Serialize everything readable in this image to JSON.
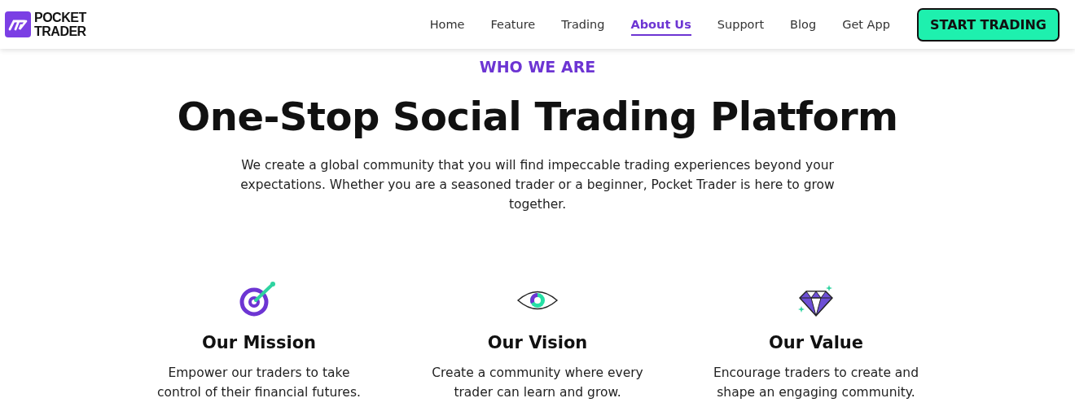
{
  "header": {
    "logo": {
      "line_1": "POCKET",
      "line_2": "TRADER"
    },
    "nav": [
      {
        "label": "Home",
        "selected": false
      },
      {
        "label": "Feature",
        "selected": false
      },
      {
        "label": "Trading",
        "selected": false
      },
      {
        "label": "About Us",
        "selected": true
      },
      {
        "label": "Support",
        "selected": false
      },
      {
        "label": "Blog",
        "selected": false
      },
      {
        "label": "Get App",
        "selected": false
      }
    ],
    "cta": "START TRADING"
  },
  "hero": {
    "eyebrow": "WHO WE ARE",
    "title": "One-Stop Social Trading Platform",
    "description": "We create a global community that you will find impeccable trading experiences beyond your expectations. Whether you are a seasoned trader or a beginner, Pocket Trader is here to grow together."
  },
  "features": [
    {
      "kind": "target",
      "title": "Our Mission",
      "description": "Empower our traders to take control of their financial futures."
    },
    {
      "kind": "eye",
      "title": "Our Vision",
      "description": "Create a community where every trader can learn and grow."
    },
    {
      "kind": "diamond",
      "title": "Our Value",
      "description": "Encourage traders to create and shape an engaging community."
    }
  ]
}
